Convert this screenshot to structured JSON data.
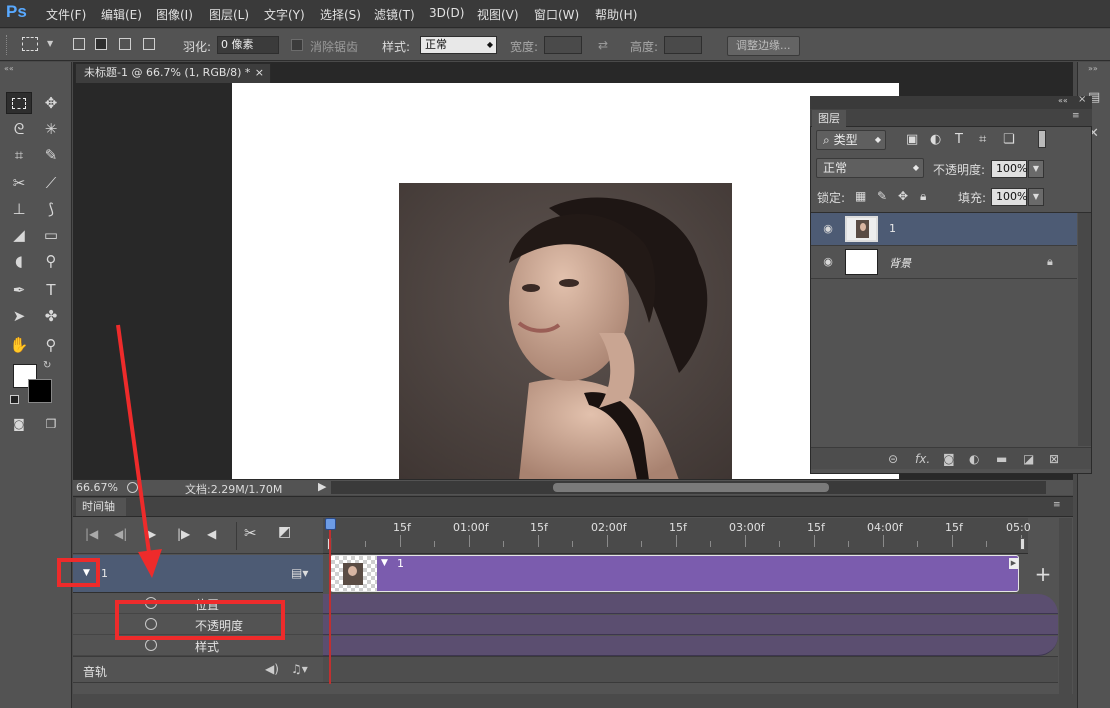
{
  "app": {
    "logo": "Ps"
  },
  "menu": [
    "文件(F)",
    "编辑(E)",
    "图像(I)",
    "图层(L)",
    "文字(Y)",
    "选择(S)",
    "滤镜(T)",
    "3D(D)",
    "视图(V)",
    "窗口(W)",
    "帮助(H)"
  ],
  "options": {
    "feather_label": "羽化:",
    "feather_value": "0 像素",
    "antialias_label": "消除锯齿",
    "style_label": "样式:",
    "style_value": "正常",
    "width_label": "宽度:",
    "height_label": "高度:",
    "refine_edge": "调整边缘..."
  },
  "document": {
    "tab_title": "未标题-1 @ 66.7% (1, RGB/8) *",
    "close": "×",
    "zoom": "66.67%",
    "doc_info": "文档:2.29M/1.70M"
  },
  "layers_panel": {
    "tab": "图层",
    "filter_kind": "类型",
    "blend_mode": "正常",
    "opacity_label": "不透明度:",
    "opacity_value": "100%",
    "lock_label": "锁定:",
    "fill_label": "填充:",
    "fill_value": "100%",
    "layers": [
      {
        "name": "1",
        "selected": true
      },
      {
        "name": "背景",
        "locked": true
      }
    ],
    "bottom_icons": [
      "link-icon",
      "fx-icon",
      "mask-icon",
      "adjustment-icon",
      "folder-icon",
      "new-layer-icon",
      "trash-icon"
    ],
    "fx": "fx."
  },
  "timeline": {
    "tab": "时间轴",
    "ruler_labels": [
      "15f",
      "01:00f",
      "15f",
      "02:00f",
      "15f",
      "03:00f",
      "15f",
      "04:00f",
      "15f",
      "05:0"
    ],
    "layer_track_name": "1",
    "clip_name": "1",
    "properties": [
      "位置",
      "不透明度",
      "样式"
    ],
    "audio_label": "音轨",
    "add": "+"
  },
  "colors": {
    "accent_blue": "#58a9ff",
    "clip_purple": "#7b5cae",
    "annotation_red": "#ee2b2b",
    "selected_row": "#4d5b74"
  }
}
